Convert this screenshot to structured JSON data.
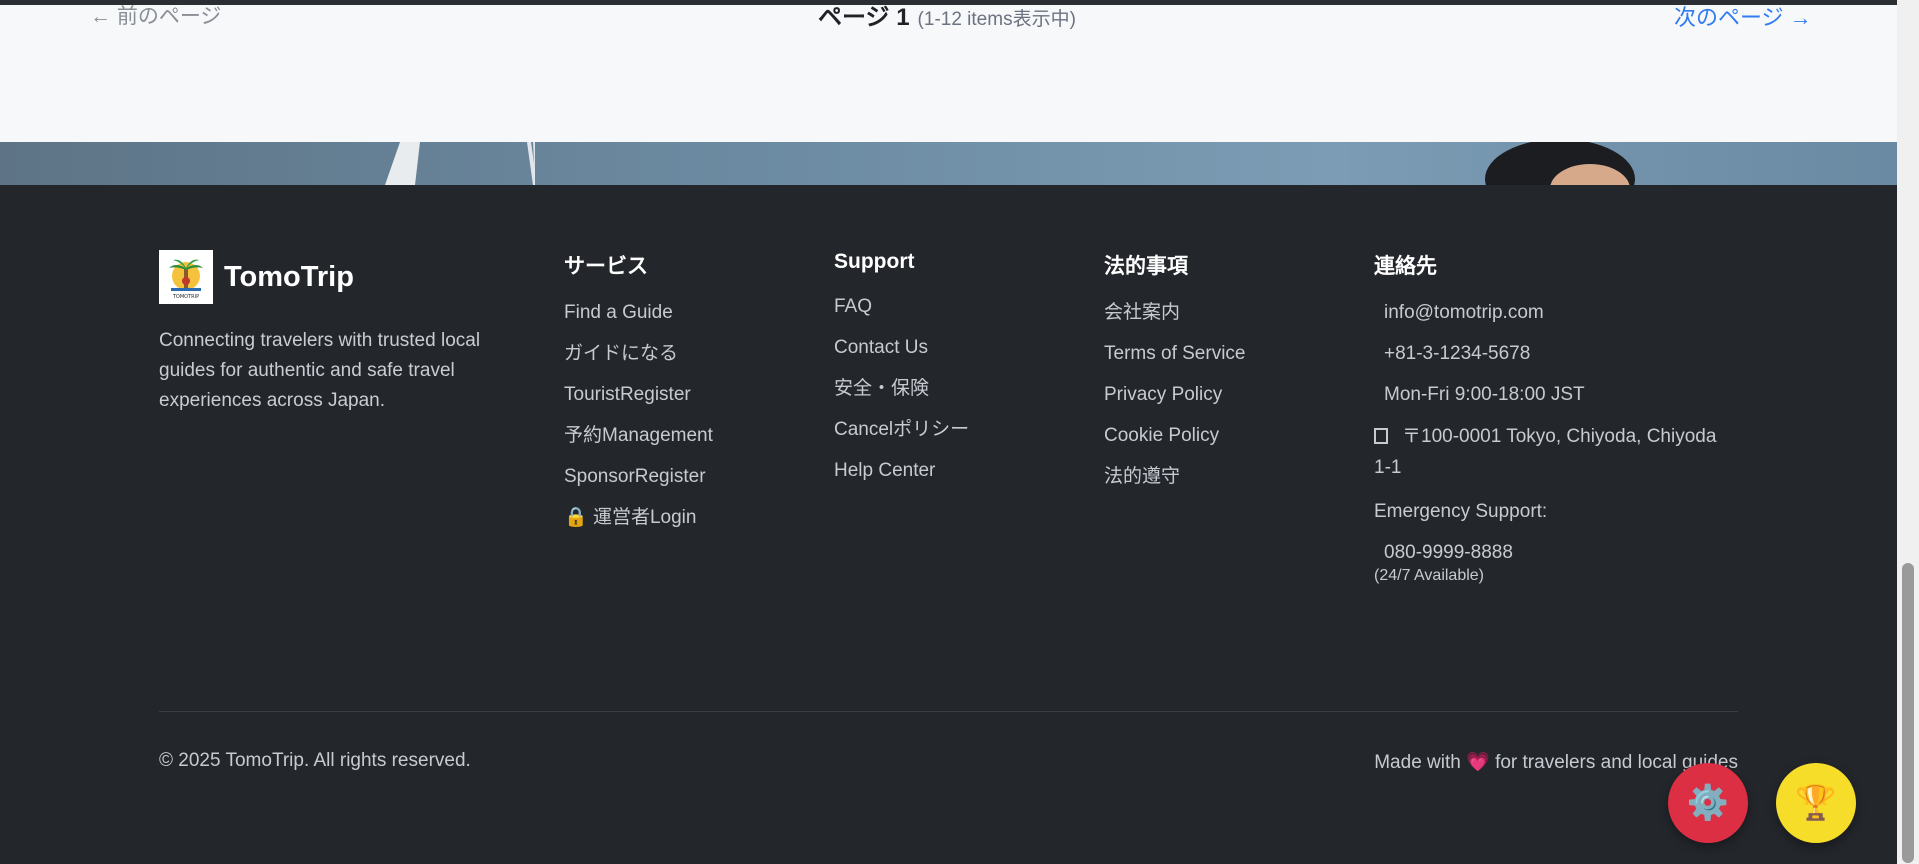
{
  "pagination": {
    "prev_label": "← 前のページ",
    "page_label": "ページ 1",
    "count_label": "(1-12 items表示中)",
    "next_label": "次のページ →"
  },
  "brand": {
    "name": "TomoTrip",
    "logo_text": "TOMOTRIP",
    "tagline": "Connecting travelers with trusted local guides for authentic and safe travel experiences across Japan."
  },
  "services": {
    "title": "サービス",
    "items": [
      "Find a Guide",
      "ガイドになる",
      "TouristRegister",
      "予約Management",
      "SponsorRegister",
      "運営者Login"
    ],
    "lock_icon": "🔒"
  },
  "support": {
    "title": "Support",
    "items": [
      "FAQ",
      "Contact Us",
      "安全・保険",
      "Cancelポリシー",
      "Help Center"
    ]
  },
  "legal": {
    "title": "法的事項",
    "items": [
      "会社案内",
      "Terms of Service",
      "Privacy Policy",
      "Cookie Policy",
      "法的遵守"
    ]
  },
  "contact": {
    "title": "連絡先",
    "email": "info@tomotrip.com",
    "phone": "+81-3-1234-5678",
    "hours": "Mon-Fri 9:00-18:00 JST",
    "address": "〒100-0001 Tokyo, Chiyoda, Chiyoda 1-1",
    "emergency_title": "Emergency Support:",
    "emergency_phone": "080-9999-8888",
    "emergency_availability": "(24/7 Available)"
  },
  "bottom": {
    "copyright": "© 2025 TomoTrip. All rights reserved.",
    "made_with_prefix": "Made with",
    "heart": "💗",
    "made_with_suffix": "for travelers and local guides"
  },
  "fabs": {
    "settings_icon": "⚙️",
    "trophy_icon": "🏆"
  },
  "colors": {
    "footer_bg": "#23262b",
    "link": "#2f7bf0",
    "settings_fab": "#dc2f43",
    "trophy_fab": "#f6dd2a"
  }
}
